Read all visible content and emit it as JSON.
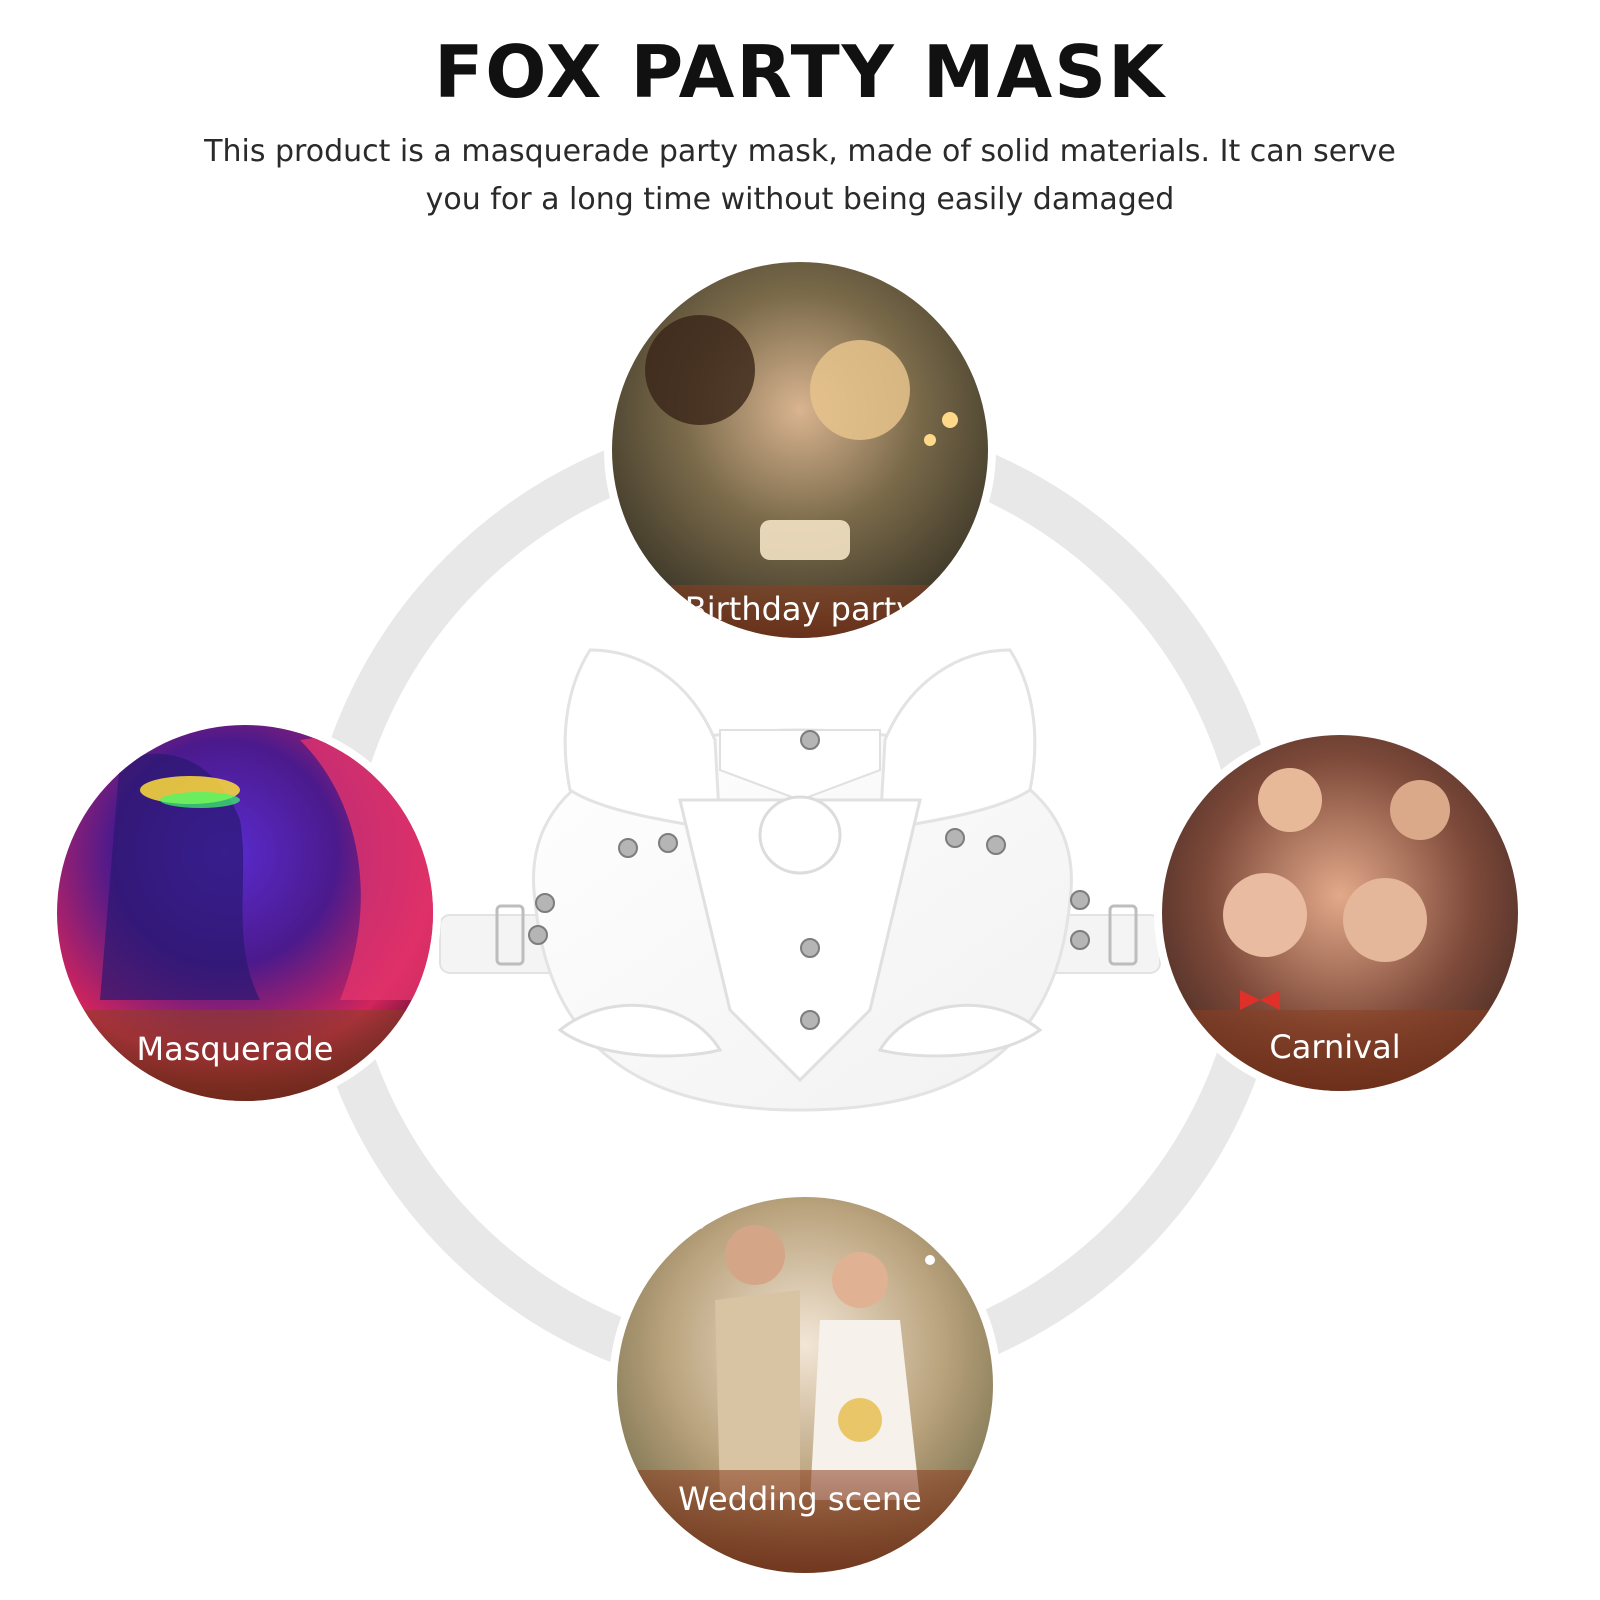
{
  "header": {
    "title": "FOX PARTY MASK",
    "description": "This product is a masquerade party mask, made of solid materials. It can serve you for a long time without being easily damaged"
  },
  "occasions": [
    {
      "label": "Birthday party",
      "icon": "birthday-photo"
    },
    {
      "label": "Masquerade",
      "icon": "masquerade-photo"
    },
    {
      "label": "Carnival",
      "icon": "carnival-photo"
    },
    {
      "label": "Wedding scene",
      "icon": "wedding-photo"
    }
  ],
  "colors": {
    "ring": "#e6e6e6",
    "mask": "#ffffff",
    "label_band": "#8a3f22",
    "text": "#111111"
  }
}
